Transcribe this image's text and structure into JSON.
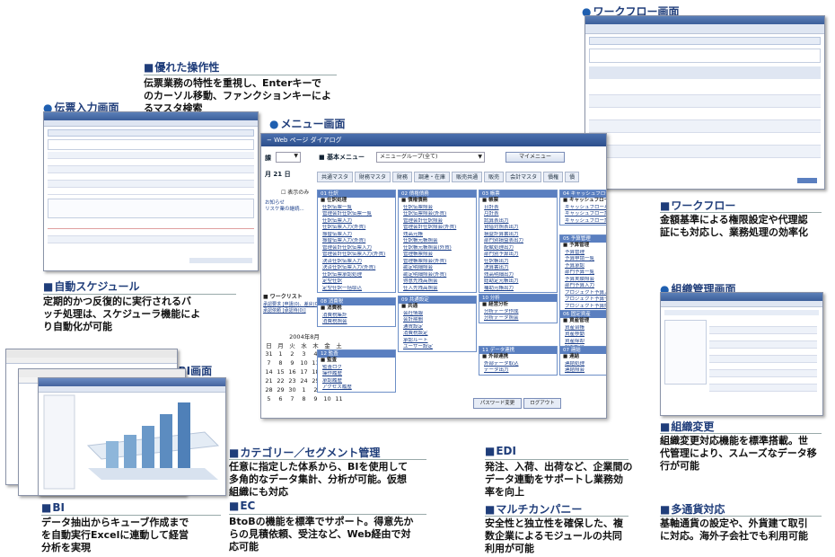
{
  "captions": {
    "sousa": {
      "title": "優れた操作性",
      "text": [
        "伝票業務の特性を重視し、Enterキーで",
        "のカーソル移動、ファンクションキーによ",
        "るマスタ検索"
      ]
    },
    "auto": {
      "title": "自動スケジュール",
      "text": [
        "定期的かつ反復的に実行されるバ",
        "ッチ処理は、スケジューラ機能によ",
        "り自動化が可能"
      ]
    },
    "bi": {
      "title": "BI",
      "text": [
        "データ抽出からキューブ作成まで",
        "を自動実行Excelに連動して経営",
        "分析を実現"
      ]
    },
    "category": {
      "title": "カテゴリー／セグメント管理",
      "text": [
        "任意に指定した体系から、BIを使用して",
        "多角的なデータ集計、分析が可能。仮想",
        "組織にも対応"
      ]
    },
    "ec": {
      "title": "EC",
      "text": [
        "BtoBの機能を標準でサポート。得意先か",
        "らの見積依頼、受注など、Web経由で対",
        "応可能"
      ]
    },
    "edi": {
      "title": "EDI",
      "text": [
        "発注、入荷、出荷など、企業間の",
        "データ連動をサポートし業務効",
        "率を向上"
      ]
    },
    "multi": {
      "title": "マルチカンパニー",
      "text": [
        "安全性と独立性を確保した、複",
        "数企業によるモジュールの共同",
        "利用が可能"
      ]
    },
    "workflow": {
      "title": "ワークフロー",
      "text": [
        "金額基準による権限設定や代理認",
        "証にも対応し、業務処理の効率化"
      ]
    },
    "soshiki": {
      "title": "組織変更",
      "text": [
        "組織変更対応機能を標準搭載。世",
        "代管理により、スムーズなデータ移",
        "行が可能"
      ]
    },
    "currency": {
      "title": "多通貨対応",
      "text": [
        "基軸通貨の設定や、外貨建て取引",
        "に対応。海外子会社でも利用可能"
      ]
    }
  },
  "screens": {
    "denpyo": "伝票入力画面",
    "menu": "メニュー画面",
    "workflow": "ワークフロー画面",
    "bi": "BI画面",
    "soshiki": "組織管理画面"
  },
  "menu_screen": {
    "topbar": "− Web ページ ダイアログ",
    "left_label": "課",
    "basic_menu": "基本メニュー",
    "menu_select": "メニューグループ(全て)",
    "my_menu": "マイメニュー",
    "date": "月 21 日",
    "tabs": [
      "共通マスタ",
      "財務マスタ",
      "財務",
      "調達・在庫",
      "販売共通",
      "販売",
      "会計マスタ",
      "債権",
      "債"
    ],
    "checkbox_label": "表示のみ",
    "notice": [
      "お知らせ",
      "リスケ業の継続..."
    ],
    "worklist": {
      "title": "ワークリスト",
      "items": [
        "承認要求 [申請(0)、差戻(0)]",
        "承認依頼 [承認待(0)]"
      ]
    },
    "calendar": {
      "month": "2004年8月",
      "headers": [
        "日",
        "月",
        "火",
        "水",
        "木",
        "金",
        "土"
      ],
      "rows": [
        [
          "31",
          "1",
          "2",
          "3",
          "4",
          "5",
          "6"
        ],
        [
          "7",
          "8",
          "9",
          "10",
          "11",
          "12",
          "13"
        ],
        [
          "14",
          "15",
          "16",
          "17",
          "18",
          "19",
          "20"
        ],
        [
          "21",
          "22",
          "23",
          "24",
          "25",
          "26",
          "27"
        ],
        [
          "28",
          "29",
          "30",
          "1",
          "2",
          "3",
          "4"
        ],
        [
          "5",
          "6",
          "7",
          "8",
          "9",
          "10",
          "11"
        ]
      ]
    },
    "panels": [
      {
        "title": "01 仕訳",
        "sub": "■ 仕訳処理",
        "items": [
          "仕訳伝票一覧",
          "管理会計仕訳伝票一覧",
          "仕訳伝票入力",
          "仕訳伝票入力(外貨)",
          "振替伝票入力",
          "振替伝票入力(外貨)",
          "管理会計仕訳伝票入力",
          "管理会計仕訳伝票入力(外貨)",
          "決済仕訳伝票入力",
          "決済仕訳伝票入力(外貨)",
          "仕訳伝票承認処理",
          "定型仕訳",
          "定型仕訳一括取込"
        ]
      },
      {
        "title": "02 債権債務",
        "sub": "■ 債権債務",
        "items": [
          "仕訳伝票照会",
          "仕訳伝票照会(外貨)",
          "管理会計仕訳照会",
          "管理会計仕訳照会(外貨)",
          "残高元帳",
          "仕訳帳元帳照会",
          "仕訳帳元帳照会(外貨)",
          "管理帳票照会",
          "管理帳票照会(外貨)",
          "勘定明細照会",
          "勘定明細照会(外貨)",
          "得意先残高照会",
          "仕入先残高照会"
        ]
      },
      {
        "title": "03 帳票",
        "sub": "■ 帳票",
        "items": [
          "日計表",
          "月計表",
          "試算表出力",
          "貸借対照表出力",
          "損益計算書出力",
          "部門別損益表出力",
          "配賦処理出力",
          "部門別予算出力",
          "仕訳帳出力",
          "決算書出力",
          "残高明細出力",
          "総勘定元帳出力",
          "補助元帳出力"
        ]
      },
      {
        "title": "04 キャッシュフロー",
        "sub": "■ キャッシュフロー計画書",
        "items": [
          "キャッシュフロー項目設定",
          "キャッシュフロー計画書",
          "キャッシュフロー計算書"
        ]
      },
      {
        "title": "05 予算管理",
        "sub": "■ 予算管理",
        "items": [
          "予算管理",
          "予算申請一覧",
          "予算承認",
          "部門予算一覧",
          "予算実績照会",
          "部門予算入力",
          "プロジェクト予算入力",
          "プロジェクト予算一覧",
          "プロジェクト予算照会"
        ]
      },
      {
        "title": "06 固定資産",
        "sub": "■ 資産管理",
        "items": [
          "資産台帳",
          "資産移動",
          "資産除却",
          "償却計算"
        ]
      },
      {
        "title": "07 連結",
        "sub": "■ 連結",
        "items": [
          "連結処理",
          "連結照会"
        ]
      },
      {
        "title": "08 消費税",
        "sub": "■ 消費税",
        "items": [
          "消費税集計",
          "消費税照会"
        ]
      },
      {
        "title": "09 共通設定",
        "sub": "■ 共通",
        "items": [
          "会社情報",
          "会計期間",
          "通貨設定",
          "消費税設定",
          "承認ルート",
          "ユーザー設定"
        ]
      },
      {
        "title": "10 分析",
        "sub": "■ 経営分析",
        "items": [
          "分析データ作成",
          "分析データ照会"
        ]
      },
      {
        "title": "11 データ連携",
        "sub": "■ 外部連携",
        "items": [
          "外部データ取込",
          "データ出力"
        ]
      },
      {
        "title": "12 監査",
        "sub": "■ 監査",
        "items": [
          "監査ログ",
          "操作履歴",
          "承認履歴",
          "アクセス履歴"
        ]
      }
    ],
    "buttons": [
      "パスワード変更",
      "ログアウト"
    ]
  },
  "colors": {
    "caption": "#1f3d7a",
    "panel_header": "#5a7fc0",
    "frame": "#8a93a8"
  }
}
